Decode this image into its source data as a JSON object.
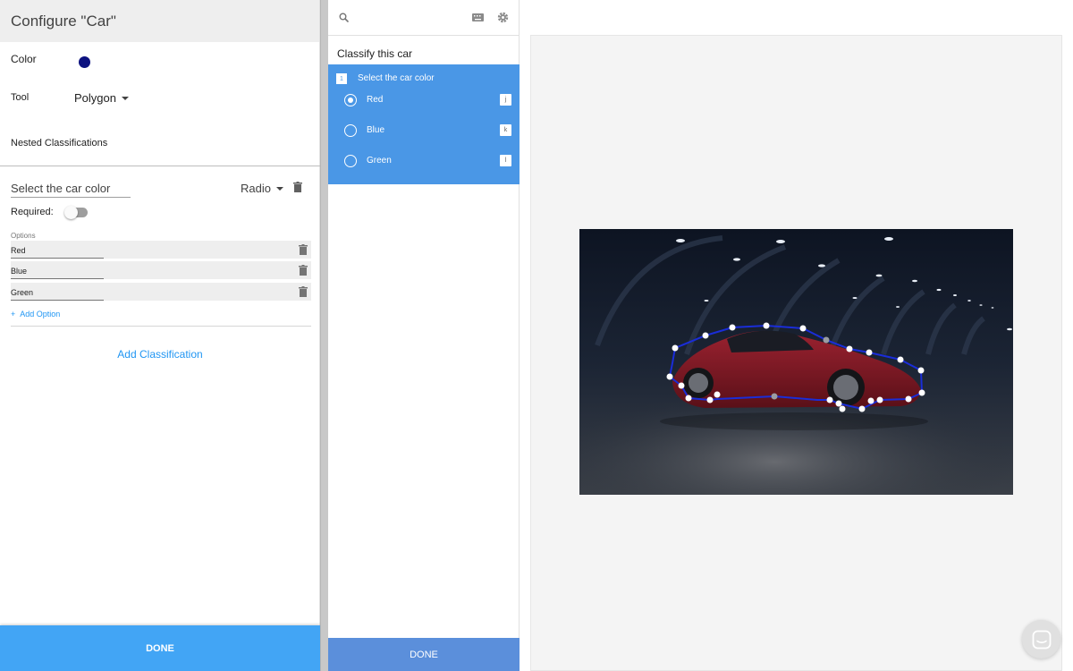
{
  "config": {
    "title": "Configure \"Car\"",
    "color_label": "Color",
    "color_value": "#0d1280",
    "tool_label": "Tool",
    "tool_value": "Polygon",
    "nested_label": "Nested Classifications",
    "question_value": "Select the car color",
    "question_type": "Radio",
    "required_label": "Required:",
    "required_on": false,
    "options_caption": "Options",
    "options": [
      {
        "label": "Red"
      },
      {
        "label": "Blue"
      },
      {
        "label": "Green"
      }
    ],
    "add_option_icon": "+",
    "add_option_label": "Add Option",
    "add_classification_label": "Add Classification",
    "done_label": "DONE"
  },
  "classify": {
    "title": "Classify this car",
    "question_number": "1",
    "question_text": "Select the car color",
    "options": [
      {
        "label": "Red",
        "hotkey": "j",
        "selected": true
      },
      {
        "label": "Blue",
        "hotkey": "k",
        "selected": false
      },
      {
        "label": "Green",
        "hotkey": "l",
        "selected": false
      }
    ],
    "done_label": "DONE",
    "toolbar_icons": [
      "search-icon",
      "keyboard-icon",
      "gear-icon"
    ]
  },
  "canvas": {
    "image_subject": "red sedan in a dark parking garage",
    "polygon_color": "#1a2dd8",
    "polygon_vertex_count": 30
  },
  "chat_icon": "chat-bubble-icon",
  "colors": {
    "accent": "#42a5f5",
    "question_block": "#4a97e6",
    "link": "#2196f3"
  }
}
